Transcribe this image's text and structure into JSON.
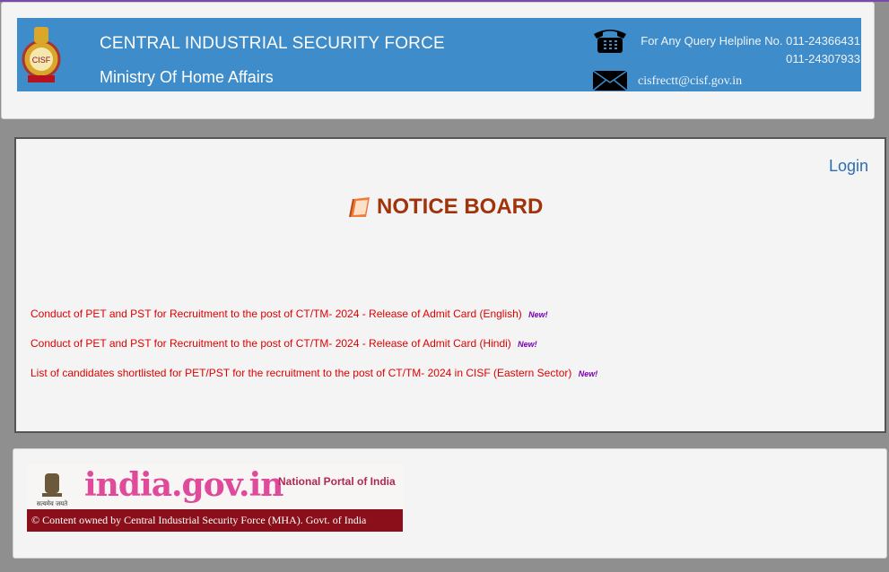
{
  "header": {
    "org_name": "CENTRAL INDUSTRIAL SECURITY FORCE",
    "ministry": "Ministry Of Home Affairs",
    "helpline_line1": "For Any Query Helpline No. 011-24366431",
    "helpline_line2": "011-24307933",
    "email": "cisfrectt@cisf.gov.in",
    "emblem_text": "CISF",
    "banner_color": "#3e8cc9"
  },
  "notice_board": {
    "login_label": "Login",
    "title": "NOTICE BOARD",
    "new_label": "New!",
    "items": [
      "Conduct of PET and PST for Recruitment to the post of CT/TM- 2024 - Release of Admit Card (English)",
      "Conduct of PET and PST for Recruitment to the post of CT/TM- 2024 - Release of Admit Card (Hindi)",
      "List of candidates shortlisted for PET/PST for the recruitment to the post of CT/TM- 2024 in CISF (Eastern Sector)"
    ]
  },
  "footer": {
    "emblem_caption": "सत्यमेव जयते",
    "portal_name": "india.gov.in",
    "portal_tagline": "National Portal of India",
    "copyright": "© Content owned by Central Industrial Security Force (MHA). Govt. of India"
  }
}
